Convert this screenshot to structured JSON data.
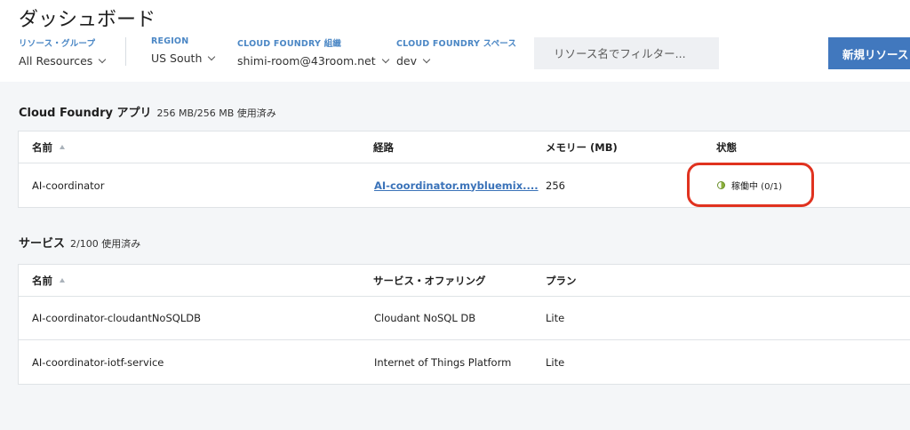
{
  "header": {
    "title": "ダッシュボード",
    "filters": [
      {
        "label": "リソース・グループ",
        "value": "All Resources"
      },
      {
        "label": "REGION",
        "value": "US South"
      },
      {
        "label": "CLOUD FOUNDRY 組織",
        "value": "shimi-room@43room.net"
      },
      {
        "label": "CLOUD FOUNDRY スペース",
        "value": "dev"
      }
    ],
    "search_placeholder": "リソース名でフィルター...",
    "new_resource_label": "新規リソース"
  },
  "cf_apps": {
    "title": "Cloud Foundry アプリ",
    "usage": "256 MB/256 MB 使用済み",
    "columns": [
      "名前",
      "経路",
      "メモリー (MB)",
      "状態"
    ],
    "rows": [
      {
        "name": "AI-coordinator",
        "route": "AI-coordinator.mybluemix....",
        "memory": "256",
        "status": "稼働中 (0/1)"
      }
    ]
  },
  "services": {
    "title": "サービス",
    "usage": "2/100 使用済み",
    "columns": [
      "名前",
      "サービス・オファリング",
      "プラン"
    ],
    "rows": [
      {
        "name": "AI-coordinator-cloudantNoSQLDB",
        "offering": "Cloudant NoSQL DB",
        "plan": "Lite"
      },
      {
        "name": "AI-coordinator-iotf-service",
        "offering": "Internet of Things Platform",
        "plan": "Lite"
      }
    ]
  },
  "colors": {
    "accent": "#4178be",
    "link": "#3b73b9",
    "highlight": "#e0321f"
  },
  "icons": [
    "chevron-down-icon",
    "sort-ascending-icon",
    "status-partial-icon"
  ]
}
